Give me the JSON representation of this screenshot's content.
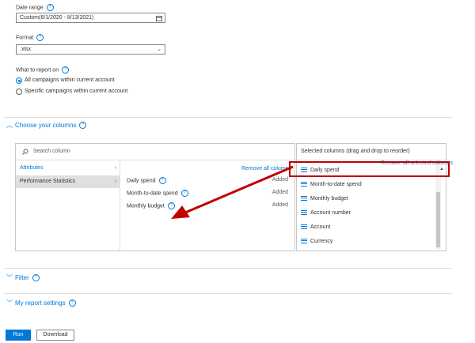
{
  "date_range": {
    "label": "Date range",
    "value": "Custom(6/1/2020 - 8/13/2021)"
  },
  "format": {
    "label": "Format",
    "value": ".xlsx"
  },
  "report_on": {
    "label": "What to report on",
    "options": [
      "All campaigns within current account",
      "Specific campaigns within current account"
    ],
    "selected": 0
  },
  "columns_section": {
    "title": "Choose your columns",
    "search_placeholder": "Search column",
    "categories": [
      "Attributes",
      "Performance Statistics"
    ],
    "remove_all_label": "Remove all columns",
    "available": [
      {
        "label": "Daily spend",
        "status": "Added"
      },
      {
        "label": "Month-to-date spend",
        "status": "Added"
      },
      {
        "label": "Monthly budget",
        "status": "Added"
      }
    ],
    "selected_header": "Selected columns (drag and drop to reorder)",
    "remove_selected_label": "Remove all selected columns",
    "selected": [
      "Daily spend",
      "Month-to-date spend",
      "Monthly budget",
      "Account number",
      "Account",
      "Currency"
    ]
  },
  "filter_section": {
    "title": "Filter"
  },
  "settings_section": {
    "title": "My report settings"
  },
  "buttons": {
    "run": "Run",
    "download": "Download"
  },
  "colors": {
    "accent": "#0078d4",
    "annotation": "#c00000"
  }
}
